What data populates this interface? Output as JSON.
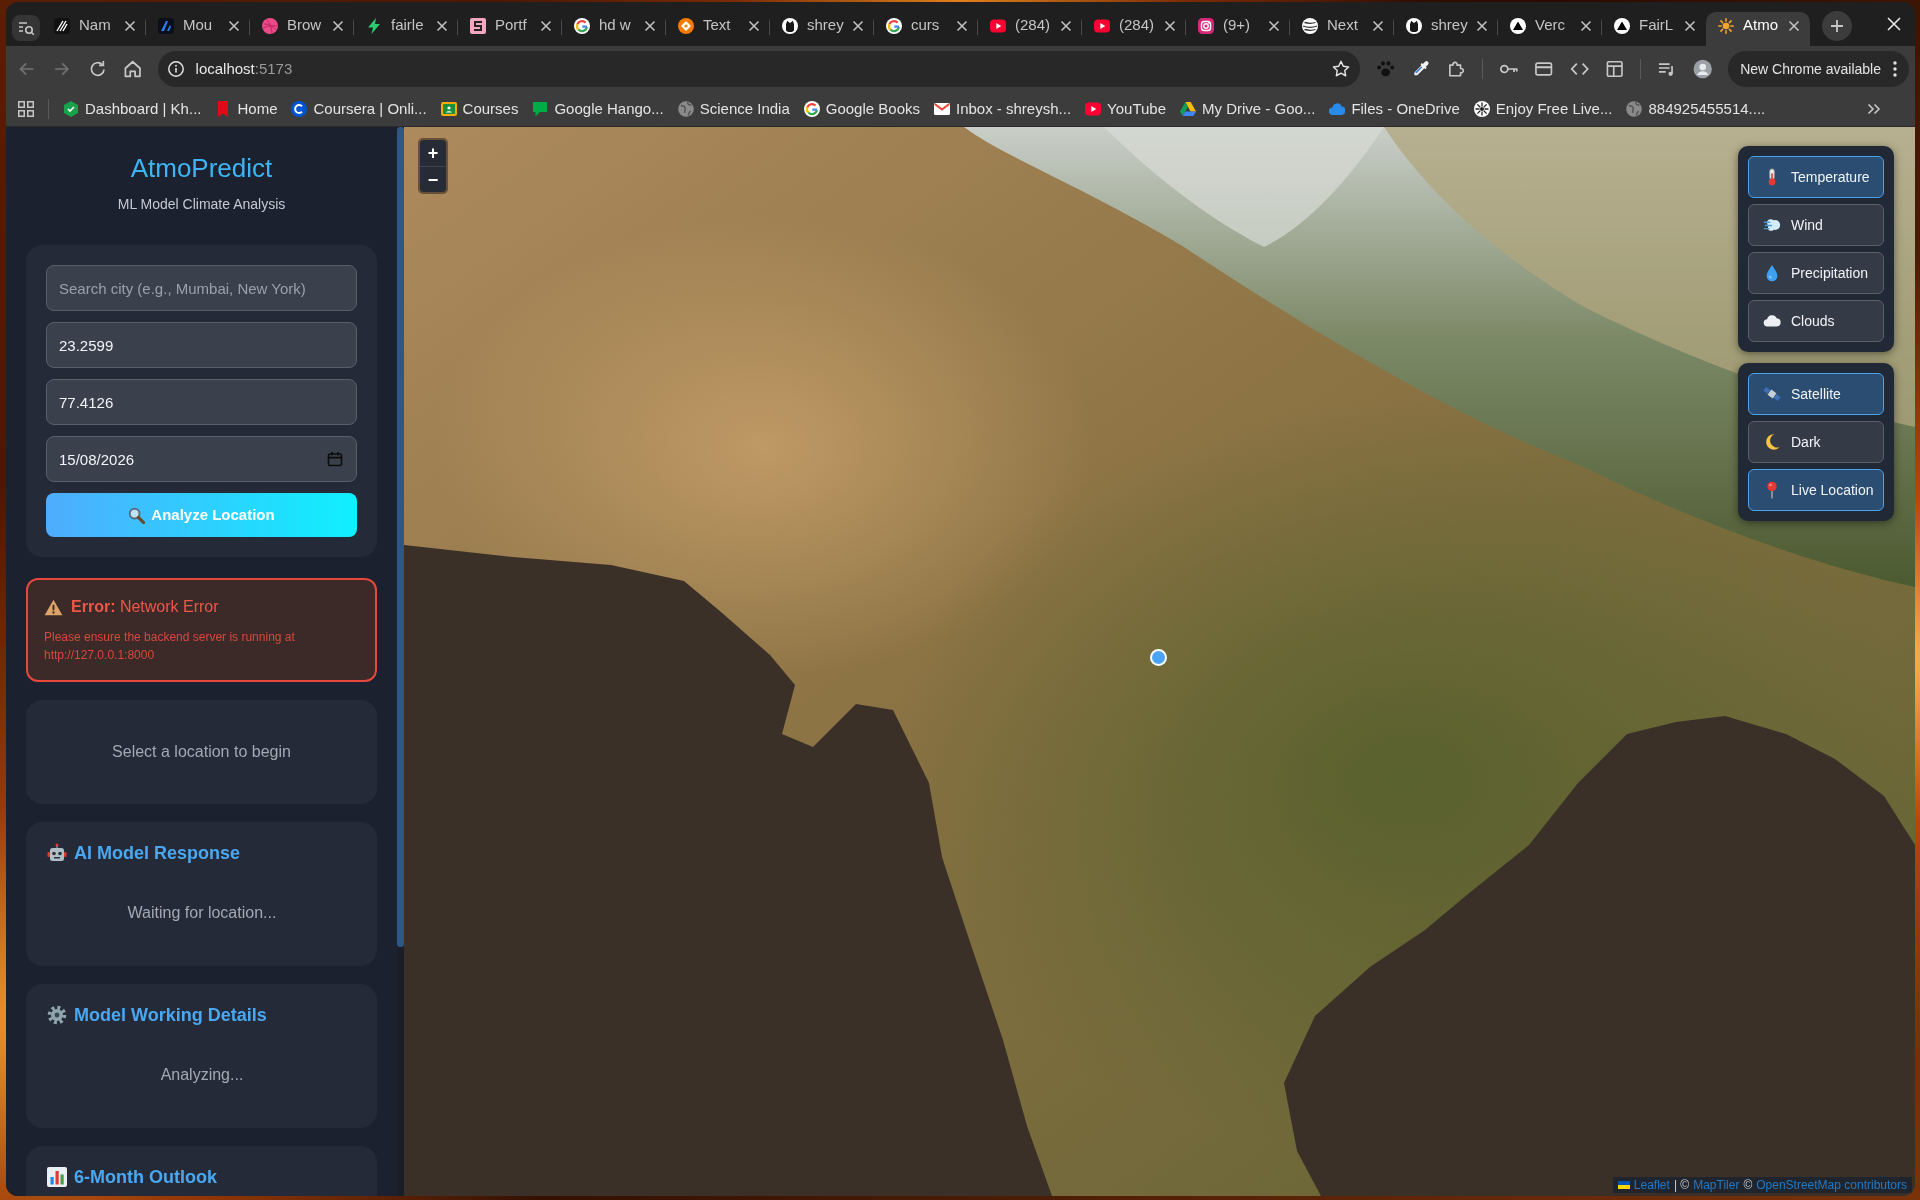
{
  "browser": {
    "tabs": [
      {
        "title": "Nam",
        "kind": "stripes",
        "selected": false
      },
      {
        "title": "Mou",
        "kind": "wedge",
        "selected": false
      },
      {
        "title": "Brow",
        "kind": "ball",
        "selected": false
      },
      {
        "title": "fairle",
        "kind": "bolt",
        "selected": false
      },
      {
        "title": "Portf",
        "kind": "tile",
        "selected": false
      },
      {
        "title": "hd w",
        "kind": "ring",
        "selected": false
      },
      {
        "title": "Text",
        "kind": "diamond",
        "selected": false
      },
      {
        "title": "shrey",
        "kind": "cat",
        "selected": false
      },
      {
        "title": "curs",
        "kind": "ring",
        "selected": false
      },
      {
        "title": "(284)",
        "kind": "play",
        "selected": false
      },
      {
        "title": "(284)",
        "kind": "play",
        "selected": false
      },
      {
        "title": "(9+)",
        "kind": "camera",
        "selected": false
      },
      {
        "title": "Next",
        "kind": "stripedball",
        "selected": false
      },
      {
        "title": "shrey",
        "kind": "cat",
        "selected": false
      },
      {
        "title": "Verc",
        "kind": "delta",
        "selected": false
      },
      {
        "title": "FairL",
        "kind": "delta",
        "selected": false
      },
      {
        "title": "Atmo",
        "kind": "sun",
        "selected": true
      }
    ],
    "toolbar": {
      "back": {
        "disabled": true
      },
      "forward": {
        "disabled": true
      },
      "url": {
        "host": "localhost",
        "rest": ":5173"
      },
      "update_button": "New Chrome available"
    },
    "bookmarks": [
      {
        "title": "Dashboard | Kh...",
        "kind": "hexagon"
      },
      {
        "title": "Home",
        "kind": "ribbon"
      },
      {
        "title": "Coursera | Onli...",
        "kind": "arc"
      },
      {
        "title": "Courses",
        "kind": "board"
      },
      {
        "title": "Google Hango...",
        "kind": "bubble"
      },
      {
        "title": "Science India",
        "kind": "globe"
      },
      {
        "title": "Google Books",
        "kind": "ring"
      },
      {
        "title": "Inbox - shreysh...",
        "kind": "envelope"
      },
      {
        "title": "YouTube",
        "kind": "play"
      },
      {
        "title": "My Drive - Goo...",
        "kind": "drive"
      },
      {
        "title": "Files - OneDrive",
        "kind": "cloud"
      },
      {
        "title": "Enjoy Free Live...",
        "kind": "wheel"
      },
      {
        "title": "884925455514....",
        "kind": "globe"
      }
    ]
  },
  "app": {
    "sidebar": {
      "title": "AtmoPredict",
      "subtitle": "ML Model Climate Analysis",
      "form": {
        "search": {
          "placeholder": "Search city (e.g., Mumbai, New York)"
        },
        "latitude": {
          "value": "23.2599"
        },
        "longitude": {
          "value": "77.4126"
        },
        "date": {
          "value": "15/08/2026"
        },
        "submit": "Analyze Location"
      },
      "error": {
        "title": "**Error:** Network Error",
        "message": "Please ensure the backend server is running at http://127.0.0.1:8000"
      },
      "status": "Select a location to begin",
      "panels": [
        {
          "kind": "robot",
          "title": "AI Model Response",
          "body": "Waiting for location..."
        },
        {
          "kind": "gear",
          "title": "Model Working Details",
          "body": "Analyzing..."
        },
        {
          "kind": "chart",
          "title": "6-Month Outlook"
        }
      ]
    },
    "map": {
      "zoom_in": "+",
      "zoom_out": "−",
      "overlays": [
        {
          "kind": "temperature",
          "label": "Temperature",
          "selected": true
        },
        {
          "kind": "wind",
          "label": "Wind",
          "selected": false
        },
        {
          "kind": "precipitation",
          "label": "Precipitation",
          "selected": false
        },
        {
          "kind": "clouds",
          "label": "Clouds",
          "selected": false
        }
      ],
      "base_layers": [
        {
          "kind": "satellite",
          "label": "Satellite",
          "selected": true
        },
        {
          "kind": "dark",
          "label": "Dark",
          "selected": false
        }
      ],
      "live_location": {
        "label": "Live Location",
        "on": true
      },
      "attribution": [
        {
          "kind": "link",
          "text": "Leaflet"
        },
        {
          "kind": "text",
          "text": "| ©"
        },
        {
          "kind": "link",
          "text": "MapTiler"
        },
        {
          "kind": "text",
          "text": "©"
        },
        {
          "kind": "link",
          "text": "OpenStreetMap contributors"
        }
      ]
    }
  }
}
